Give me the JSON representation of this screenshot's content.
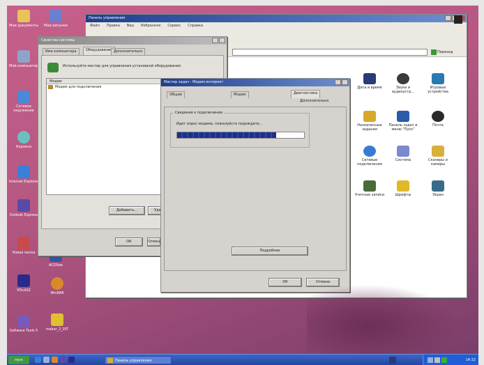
{
  "desktop": {
    "icons": [
      {
        "label": "Мои документы",
        "color": "#e8c35a"
      },
      {
        "label": "Мой компьютер",
        "color": "#8fa3c8"
      },
      {
        "label": "Сетевое окружение",
        "color": "#4a8ad8"
      },
      {
        "label": "Корзина",
        "color": "#6ac0c0"
      },
      {
        "label": "Internet Explorer",
        "color": "#3a7fd8"
      },
      {
        "label": "Outlook Express",
        "color": "#5a4aa8"
      },
      {
        "label": "Новая папка",
        "color": "#c84a4a"
      },
      {
        "label": "ACDSee",
        "color": "#3355aa"
      },
      {
        "label": "VDubS2",
        "color": "#2a2a8a"
      },
      {
        "label": "Software Tools 5",
        "color": "#7a5ab8"
      },
      {
        "label": "WinRAR",
        "color": "#d88a2a"
      },
      {
        "label": "msbar_2_DIT",
        "color": "#e0c030"
      },
      {
        "label": "Мои рисунки",
        "color": "#6a7fd0"
      }
    ]
  },
  "control_panel": {
    "title": "Панель управления",
    "menu": [
      "Файл",
      "Правка",
      "Вид",
      "Избранное",
      "Сервис",
      "Справка"
    ],
    "go_label": "Переход",
    "items": [
      {
        "label": "Дата и время",
        "color": "#2a3a7a"
      },
      {
        "label": "Звуки и аудиоустр...",
        "color": "#3a3a3a"
      },
      {
        "label": "Игровые устройства",
        "color": "#2a7ab0"
      },
      {
        "label": "Назначенные задания",
        "color": "#d8a82a"
      },
      {
        "label": "Панель задач и меню \"Пуск\"",
        "color": "#2a5aaa"
      },
      {
        "label": "Почта",
        "color": "#2a2a2a"
      },
      {
        "label": "Сетевые подключения",
        "color": "#3a7ad0"
      },
      {
        "label": "Система",
        "color": "#7a8acc"
      },
      {
        "label": "Сканеры и камеры",
        "color": "#d8b03a"
      },
      {
        "label": "Учетные записи",
        "color": "#4a6a3a"
      },
      {
        "label": "Шрифты",
        "color": "#e0b82a"
      },
      {
        "label": "Экран",
        "color": "#3a6a8a"
      }
    ]
  },
  "back_dialog": {
    "title": "Свойства системы",
    "tabs": [
      "Имя компьютера",
      "Оборудование",
      "Дополнительно"
    ],
    "header_text": "Используйте мастер для управления установкой оборудования",
    "column_label": "Модем",
    "list_item": "Модем для подключения",
    "buttons": [
      "Добавить...",
      "Удалить"
    ],
    "ok_label": "ОК",
    "cancel_label": "Отмена"
  },
  "front_dialog": {
    "title": "Мастер задач - Модем интернет",
    "tabs": [
      "Общие",
      "Модем",
      "Диагностика",
      "Дополнительно"
    ],
    "group_label": "Сведения о подключении",
    "progress_caption": "Идет опрос модема, пожалуйста подождите...",
    "progress": 0.78,
    "details_button": "Подробнее",
    "ok_label": "ОК",
    "cancel_label": "Отмена"
  },
  "taskbar": {
    "start_label": "пуск",
    "task_label": "Панель управления",
    "clock": "14:32"
  }
}
